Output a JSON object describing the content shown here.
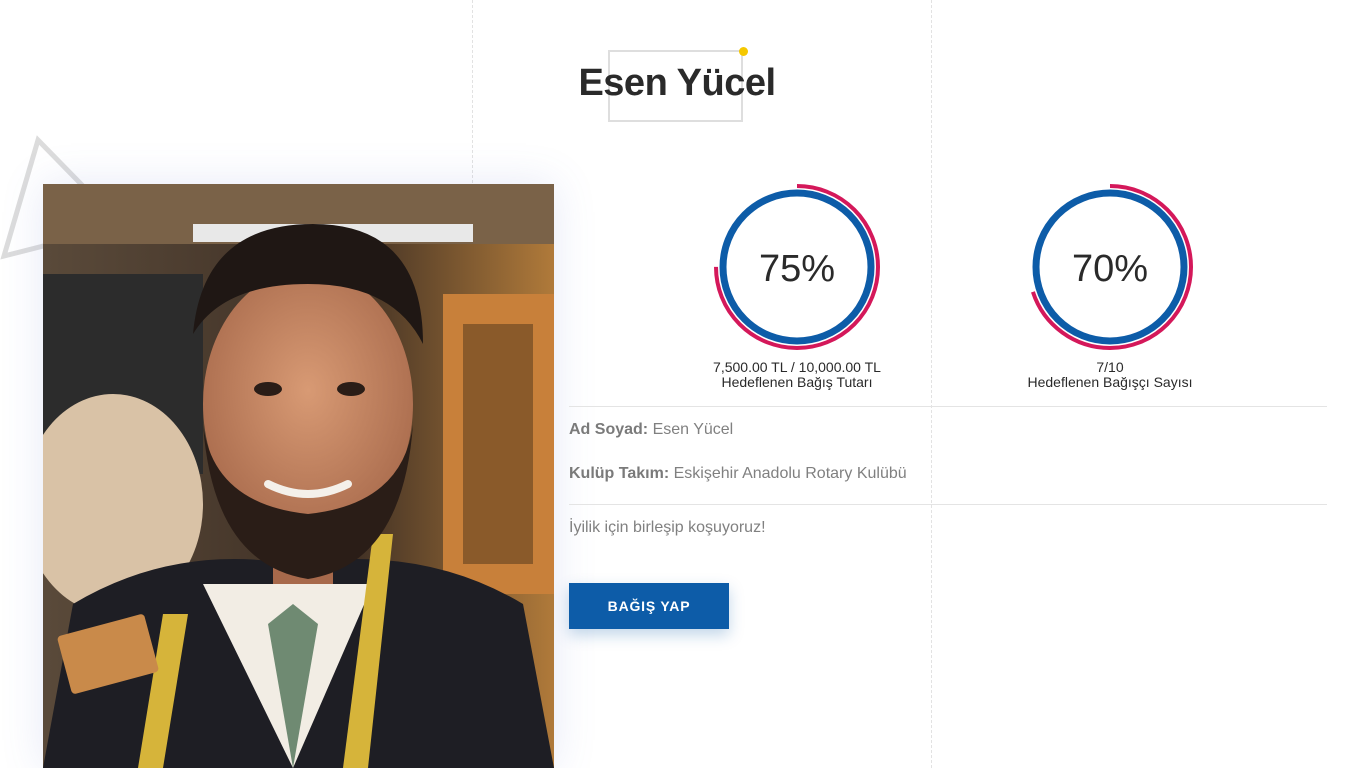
{
  "profile": {
    "name": "Esen Yücel"
  },
  "stats": [
    {
      "percent_text": "75%",
      "percent": 75,
      "value": "7,500.00 TL / 10,000.00 TL",
      "label": "Hedeflenen Bağış Tutarı"
    },
    {
      "percent_text": "70%",
      "percent": 70,
      "value": "7/10",
      "label": "Hedeflenen Bağışçı Sayısı"
    }
  ],
  "details": {
    "name_label": "Ad Soyad:",
    "name_value": "Esen Yücel",
    "club_label": "Kulüp Takım:",
    "club_value": "Eskişehir Anadolu Rotary Kulübü"
  },
  "motto": "İyilik için birleşip koşuyoruz!",
  "actions": {
    "donate_label": "BAĞIŞ YAP"
  },
  "colors": {
    "ring_inner": "#0d5ca8",
    "ring_outer": "#d4185a",
    "button": "#0d5ca8",
    "title_dot": "#f5c800"
  },
  "icons": {
    "decoration": "triangle-outline-icon"
  }
}
